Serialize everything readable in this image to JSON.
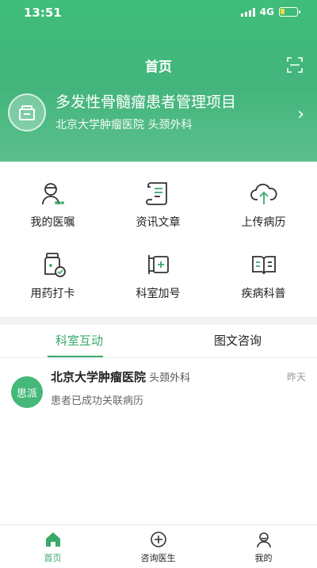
{
  "status_bar": {
    "time": "13:51",
    "network": "4G",
    "battery_level": 0.25
  },
  "header": {
    "title": "首页",
    "project": {
      "title": "多发性骨髓瘤患者管理项目",
      "subtitle": "北京大学肿瘤医院 头颈外科"
    }
  },
  "grid": [
    {
      "label": "我的医嘱",
      "icon": "doctor-icon"
    },
    {
      "label": "资讯文章",
      "icon": "scroll-icon"
    },
    {
      "label": "上传病历",
      "icon": "cloud-upload-icon"
    },
    {
      "label": "用药打卡",
      "icon": "medicine-bottle-icon"
    },
    {
      "label": "科室加号",
      "icon": "clinic-plus-icon"
    },
    {
      "label": "疾病科普",
      "icon": "open-book-icon"
    }
  ],
  "tabs": [
    {
      "label": "科室互动"
    },
    {
      "label": "图文咨询"
    }
  ],
  "active_tab": 0,
  "messages": [
    {
      "avatar_text": "思派",
      "hospital": "北京大学肿瘤医院",
      "department": "头颈外科",
      "time": "昨天",
      "text": "患者已成功关联病历"
    }
  ],
  "bottom_nav": [
    {
      "label": "首页",
      "icon": "home-icon",
      "active": true
    },
    {
      "label": "咨询医生",
      "icon": "plus-circle-icon",
      "active": false
    },
    {
      "label": "我的",
      "icon": "user-icon",
      "active": false
    }
  ],
  "colors": {
    "accent": "#3aaa6a",
    "header_green": "#43b57c",
    "battery": "#f1d94b"
  }
}
